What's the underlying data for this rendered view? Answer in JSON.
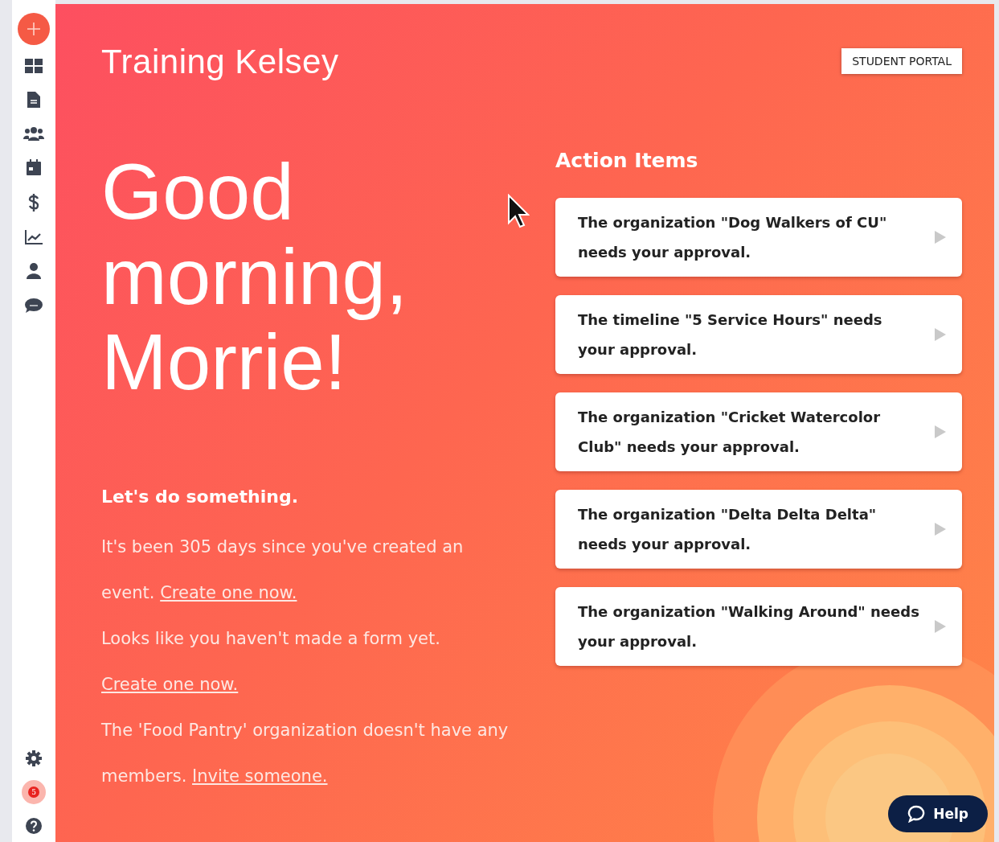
{
  "header": {
    "title": "Training Kelsey",
    "portal_button": "STUDENT PORTAL"
  },
  "greeting": "Good morning, Morrie!",
  "prompt_heading": "Let's do something.",
  "suggestions": [
    {
      "text": "It's been 305 days since you've created an event.",
      "link": "Create one now."
    },
    {
      "text": "Looks like you haven't made a form yet.",
      "link": "Create one now."
    },
    {
      "text": "The 'Food Pantry' organization doesn't have any members.",
      "link": "Invite someone."
    }
  ],
  "action_items": {
    "heading": "Action Items",
    "items": [
      "The organization \"Dog Walkers of CU\" needs your approval.",
      "The timeline \"5 Service Hours\" needs your approval.",
      "The organization \"Cricket Watercolor Club\" needs your approval.",
      "The organization \"Delta Delta Delta\" needs your approval.",
      "The organization \"Walking Around\" needs your approval."
    ]
  },
  "sidebar": {
    "notification_count": "5"
  },
  "help_button": "Help"
}
